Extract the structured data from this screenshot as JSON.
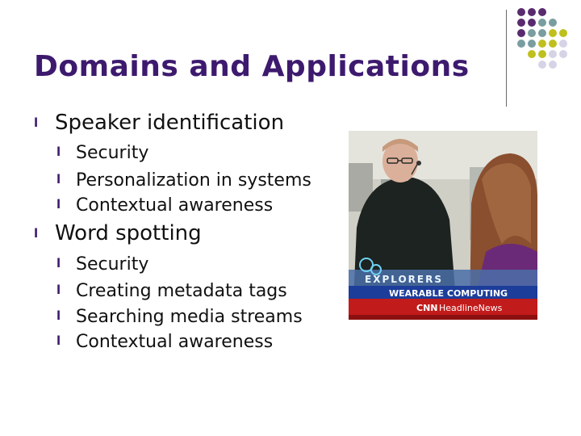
{
  "slide": {
    "title": "Domains and Applications",
    "bullet_marker": "l",
    "sections": [
      {
        "label": "Speaker identification",
        "items": [
          "Security",
          "Personalization in systems",
          "Contextual awareness"
        ]
      },
      {
        "label": "Word spotting",
        "items": [
          "Security",
          "Creating metadata tags",
          "Searching media streams",
          "Contextual awareness"
        ]
      }
    ]
  },
  "decor": {
    "dot_colors": {
      "purple": "#5a2a6e",
      "teal": "#7a9ea0",
      "olive": "#bfc01e",
      "lavender": "#d6d3e6"
    },
    "dot_pattern": [
      [
        "purple",
        "purple",
        "purple",
        "",
        ""
      ],
      [
        "purple",
        "purple",
        "teal",
        "teal",
        ""
      ],
      [
        "purple",
        "teal",
        "teal",
        "olive",
        "olive"
      ],
      [
        "teal",
        "teal",
        "olive",
        "olive",
        "lavender"
      ],
      [
        "",
        "olive",
        "olive",
        "lavender",
        "lavender"
      ],
      [
        "",
        "",
        "lavender",
        "lavender",
        ""
      ]
    ]
  },
  "photo": {
    "brand": "EXPLORERS",
    "caption": "WEARABLE COMPUTING",
    "network_prefix": "CNN",
    "network_name": "HeadlineNews"
  }
}
